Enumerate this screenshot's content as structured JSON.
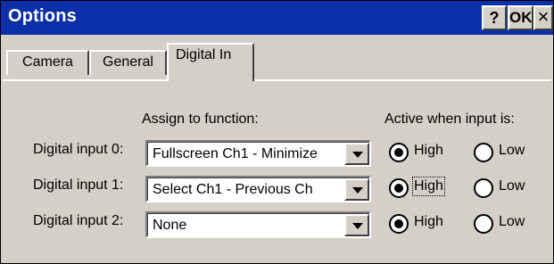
{
  "window": {
    "title": "Options",
    "help_label": "?",
    "ok_label": "OK",
    "close_label": "×"
  },
  "tabs": [
    {
      "label": "Camera"
    },
    {
      "label": "General"
    },
    {
      "label": "Digital In"
    }
  ],
  "headers": {
    "assign": "Assign to function:",
    "active": "Active when input is:"
  },
  "rows": [
    {
      "label": "Digital input 0:",
      "function": "Fullscreen Ch1 - Minimize",
      "high_label": "High",
      "low_label": "Low",
      "selected": "High"
    },
    {
      "label": "Digital input 1:",
      "function": "Select Ch1 - Previous Ch",
      "high_label": "High",
      "low_label": "Low",
      "selected": "High"
    },
    {
      "label": "Digital input 2:",
      "function": "None",
      "high_label": "High",
      "low_label": "Low",
      "selected": "High"
    }
  ],
  "colors": {
    "titlebar": "#0a2fa8",
    "face": "#d4d0c8"
  }
}
